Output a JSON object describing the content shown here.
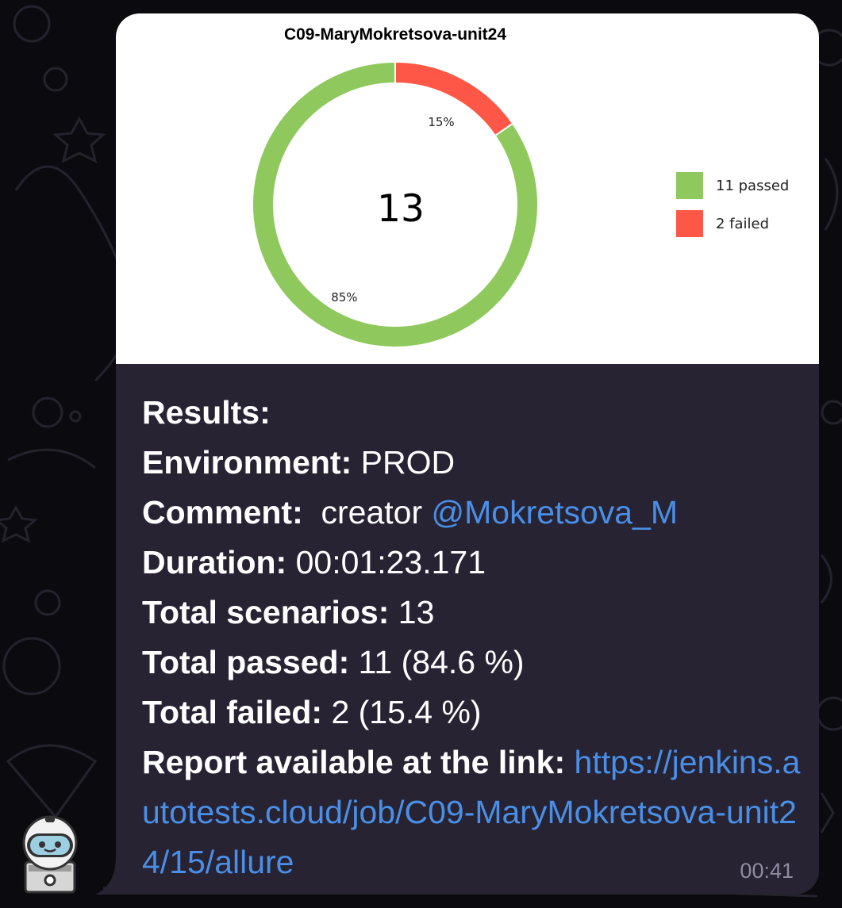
{
  "chart_data": {
    "type": "pie",
    "title": "C09-MaryMokretsova-unit24",
    "center_text": "13",
    "slices": [
      {
        "label": "11 passed",
        "value": 11,
        "percent_label": "85%",
        "color": "#8fc95e"
      },
      {
        "label": "2 failed",
        "value": 2,
        "percent_label": "15%",
        "color": "#ff5747"
      }
    ],
    "legend_position": "right"
  },
  "message": {
    "results_label": "Results:",
    "environment_label": "Environment:",
    "environment_value": "PROD",
    "comment_label": "Comment:",
    "comment_value": "creator",
    "comment_mention": "@Mokretsova_M",
    "duration_label": "Duration:",
    "duration_value": "00:01:23.171",
    "total_label": "Total scenarios:",
    "total_value": "13",
    "passed_label": "Total passed:",
    "passed_value": "11 (84.6 %)",
    "failed_label": "Total failed:",
    "failed_value": "2 (15.4 %)",
    "report_label": "Report available at the link:",
    "report_link": "https://jenkins.autotests.cloud/job/C09-MaryMokretsova-unit24/15/allure",
    "time": "00:41"
  },
  "colors": {
    "background": "#0b0b0f",
    "bubble": "#272333",
    "link": "#4a8fe7",
    "passed": "#8fc95e",
    "failed": "#ff5747"
  },
  "icons": {
    "avatar": "robot-avatar-icon"
  }
}
